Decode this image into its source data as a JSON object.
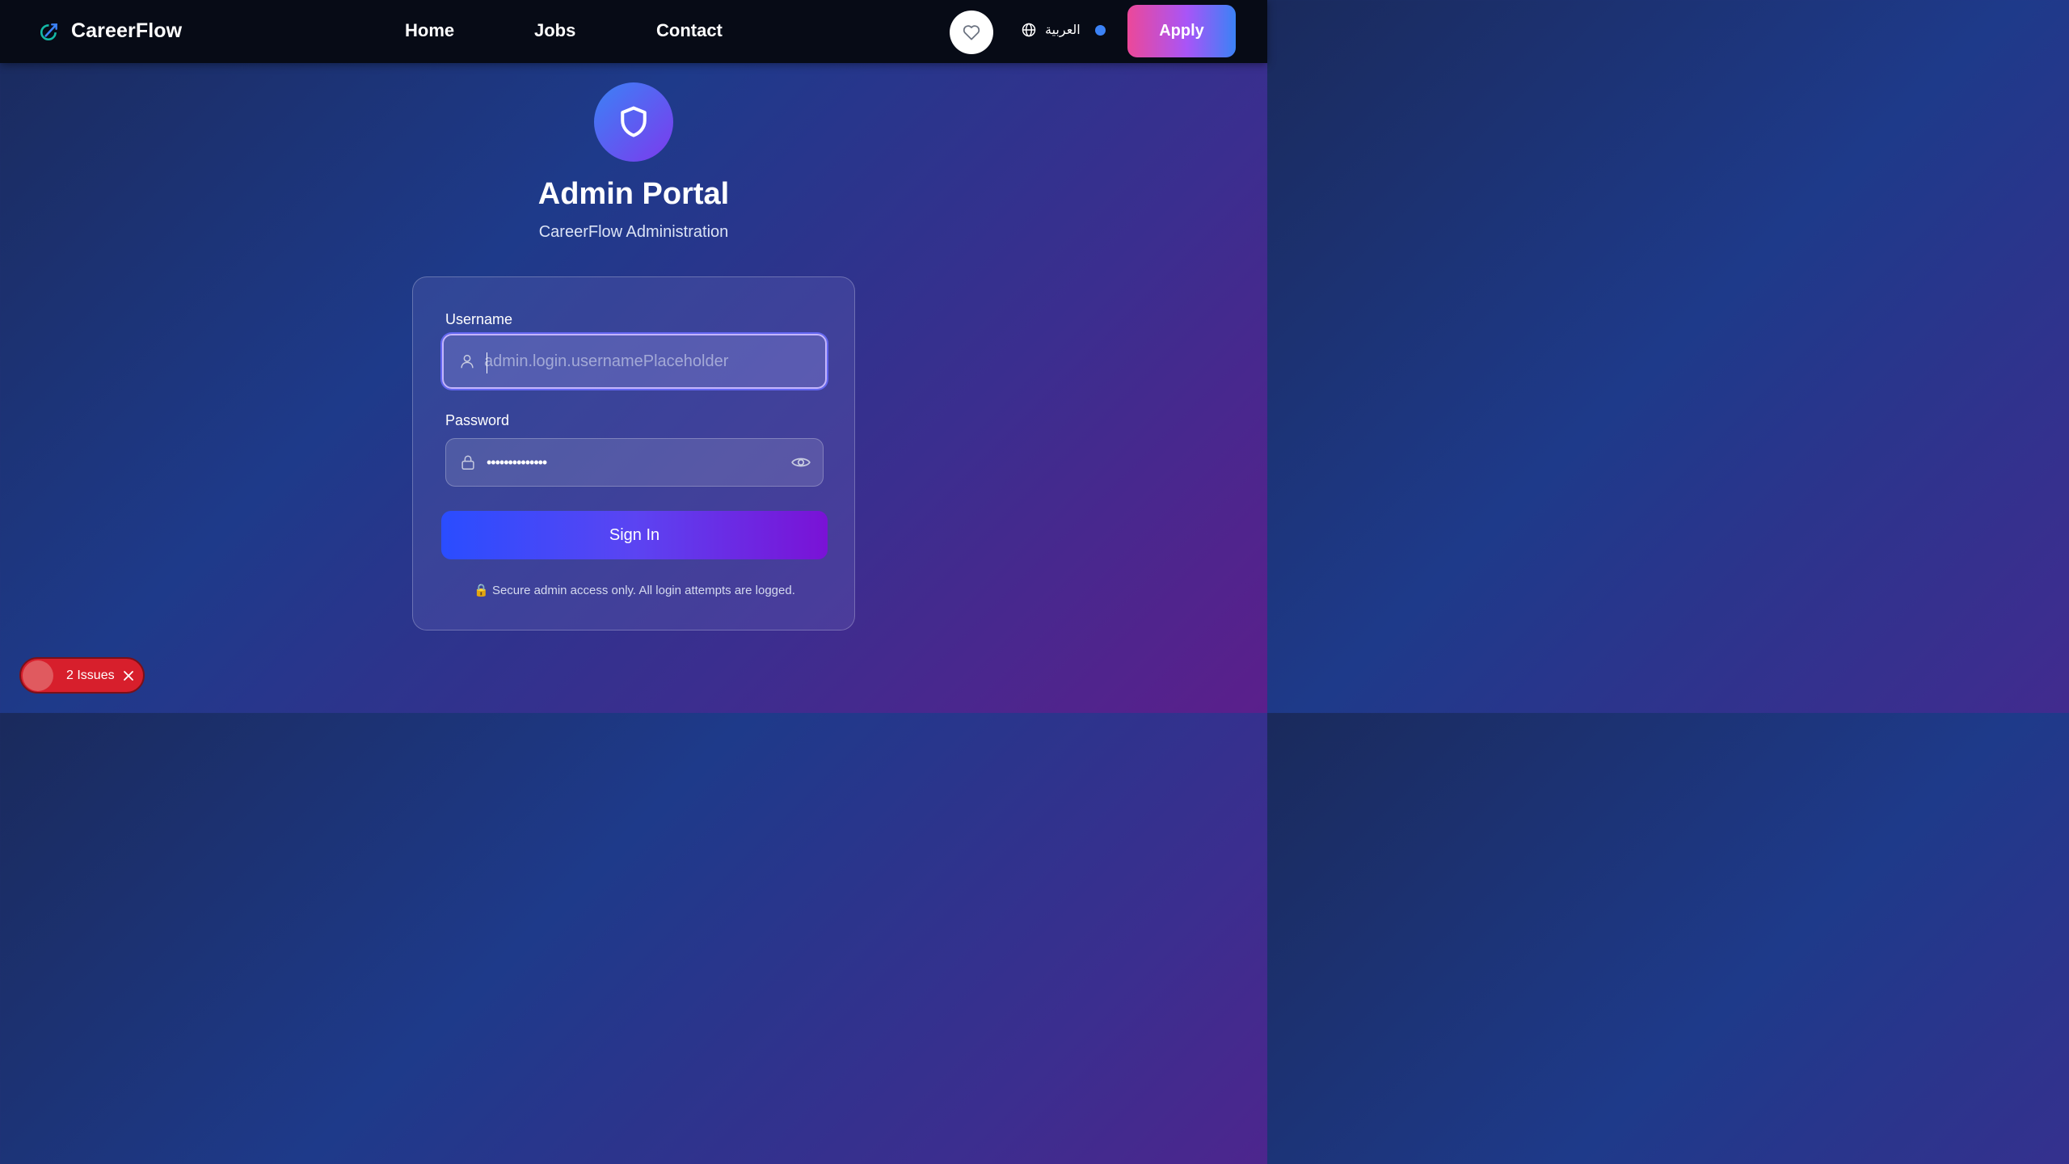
{
  "nav": {
    "brand": "CareerFlow",
    "links": [
      "Home",
      "Jobs",
      "Contact"
    ],
    "language": "العربية",
    "apply_label": "Apply"
  },
  "hero": {
    "title": "Admin Portal",
    "subtitle": "CareerFlow Administration"
  },
  "form": {
    "username_label": "Username",
    "username_placeholder": "admin.login.usernamePlaceholder",
    "username_value": "",
    "password_label": "Password",
    "password_value": "••••••••••••••",
    "signin_label": "Sign In",
    "secure_note": "🔒 Secure admin access only. All login attempts are logged."
  },
  "issues": {
    "label": "2 Issues"
  },
  "colors": {
    "accent_blue": "#3b82f6",
    "accent_purple": "#7c3aed",
    "apply_pink": "#ec4899",
    "issues_red": "#d71f2c"
  },
  "icons": [
    "compass-logo-icon",
    "heart-icon",
    "globe-icon",
    "shield-icon",
    "user-icon",
    "lock-icon",
    "eye-icon",
    "close-icon"
  ]
}
